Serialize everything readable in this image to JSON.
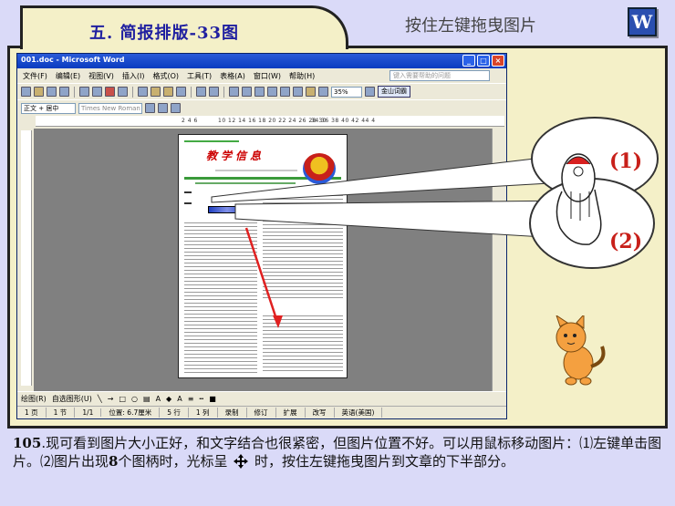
{
  "slide": {
    "title": "五. 简报排版-33图",
    "subtitle": "按住左键拖曳图片",
    "logo_letter": "W"
  },
  "window": {
    "title": "001.doc - Microsoft Word",
    "menu": [
      "文件(F)",
      "编辑(E)",
      "视图(V)",
      "插入(I)",
      "格式(O)",
      "工具(T)",
      "表格(A)",
      "窗口(W)",
      "帮助(H)"
    ],
    "help_placeholder": "键入需要帮助的问题",
    "zoom": "35%",
    "jinshan": "金山词霸",
    "style": "正文 + 居中",
    "font": "Times New Roman",
    "ruler_left": "2 4 6",
    "ruler_mid": "10 12 14 16 18 20 22 24 26 28 30",
    "ruler_right": "34 36 38 40 42 44 4",
    "newsletter_title": "教学信息",
    "draw_label": "绘图(R)",
    "autoshape_label": "自选图形(U)",
    "status": {
      "page": "1 页",
      "section": "1 节",
      "pages": "1/1",
      "position": "位置: 6.7厘米",
      "line": "5 行",
      "col": "1 列",
      "rec": "录制",
      "rev": "修订",
      "ext": "扩展",
      "ovr": "改写",
      "lang": "英语(美国)"
    }
  },
  "labels": {
    "one": "(1)",
    "two": "(2)"
  },
  "caption": {
    "num": "105",
    "line1": ".现可看到图片大小正好，和文字结合也很紧密，但图片位置不好。可以用鼠标移动图片：⑴左键单击图片。⑵图片出现",
    "eight": "8",
    "line2": "个图柄时，光标呈",
    "line3": "时，按住左键拖曳图片到文章的下半部分。"
  }
}
